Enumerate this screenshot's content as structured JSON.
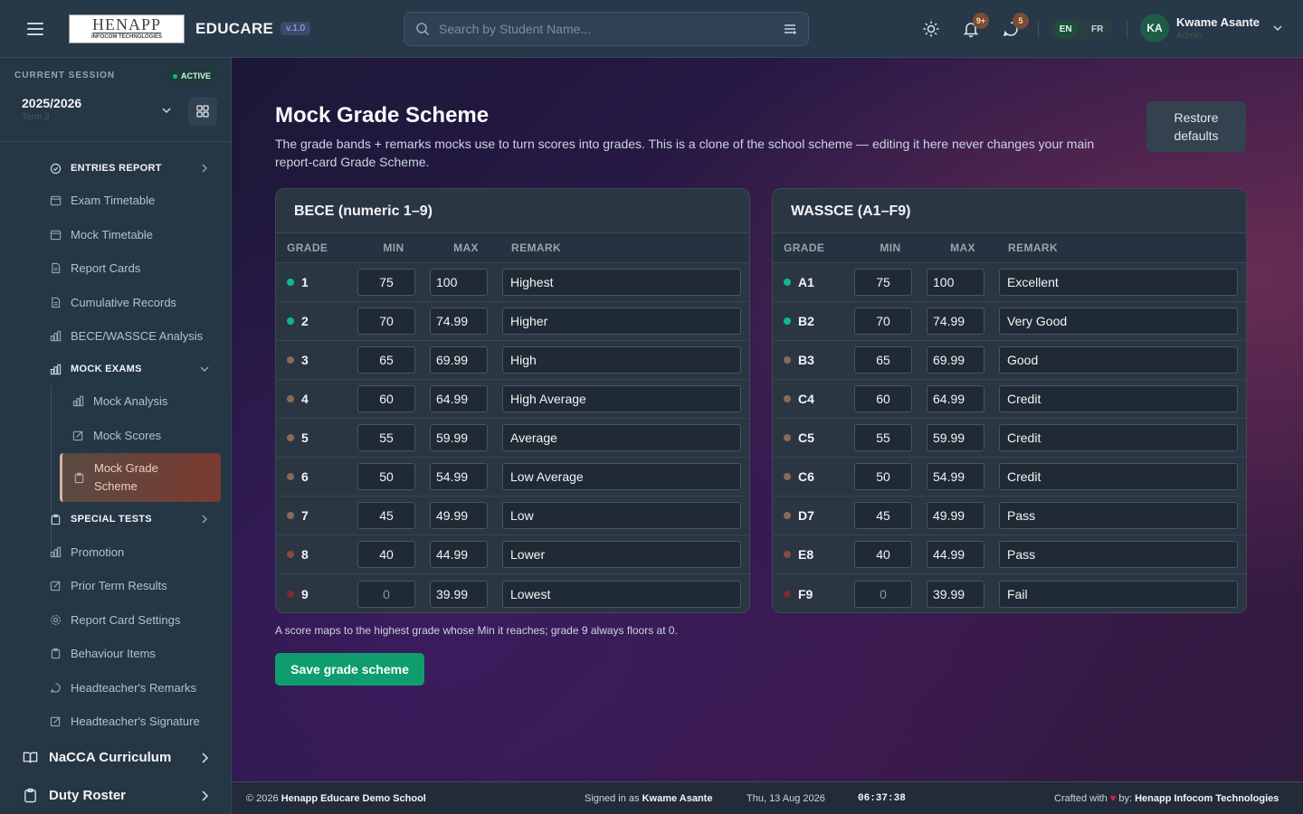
{
  "header": {
    "logo_big": "HENAPP",
    "logo_small": "INFOCOM TECHNOLOGIES",
    "brand": "EDUCARE",
    "version": "v.1.0",
    "search_placeholder": "Search by Student Name...",
    "notifications_badge": "9+",
    "messages_badge": "5",
    "lang_en": "EN",
    "lang_fr": "FR",
    "user_initials": "KA",
    "user_name": "Kwame Asante",
    "user_role": "Admin"
  },
  "sidebar": {
    "session_label": "CURRENT SESSION",
    "active_label": "ACTIVE",
    "session_year": "2025/2026",
    "session_term": "Term 3",
    "entries_report": "ENTRIES REPORT",
    "exam_timetable": "Exam Timetable",
    "mock_timetable": "Mock Timetable",
    "report_cards": "Report Cards",
    "cumulative_records": "Cumulative Records",
    "bece_wassce_analysis": "BECE/WASSCE Analysis",
    "mock_exams": "MOCK EXAMS",
    "mock_analysis": "Mock Analysis",
    "mock_scores": "Mock Scores",
    "mock_grade_scheme_line1": "Mock Grade",
    "mock_grade_scheme_line2": "Scheme",
    "special_tests": "SPECIAL TESTS",
    "promotion": "Promotion",
    "prior_term_results": "Prior Term Results",
    "report_card_settings": "Report Card Settings",
    "behaviour_items": "Behaviour Items",
    "headteachers_remarks": "Headteacher's Remarks",
    "headteachers_signature": "Headteacher's Signature",
    "nacca_curriculum": "NaCCA Curriculum",
    "duty_roster": "Duty Roster"
  },
  "main": {
    "title": "Mock Grade Scheme",
    "description": "The grade bands + remarks mocks use to turn scores into grades. This is a clone of the school scheme — editing it here never changes your main report-card Grade Scheme.",
    "restore_line1": "Restore",
    "restore_line2": "defaults",
    "columns": {
      "grade": "GRADE",
      "min": "MIN",
      "max": "MAX",
      "remark": "REMARK"
    },
    "bece": {
      "title": "BECE (numeric 1–9)",
      "rows": [
        {
          "grade": "1",
          "min": "75",
          "max": "100",
          "remark": "Highest",
          "color": "#10b981"
        },
        {
          "grade": "2",
          "min": "70",
          "max": "74.99",
          "remark": "Higher",
          "color": "#10b981"
        },
        {
          "grade": "3",
          "min": "65",
          "max": "69.99",
          "remark": "High",
          "color": "#8a6a55"
        },
        {
          "grade": "4",
          "min": "60",
          "max": "64.99",
          "remark": "High Average",
          "color": "#8a6a55"
        },
        {
          "grade": "5",
          "min": "55",
          "max": "59.99",
          "remark": "Average",
          "color": "#8a6a55"
        },
        {
          "grade": "6",
          "min": "50",
          "max": "54.99",
          "remark": "Low Average",
          "color": "#8a6a55"
        },
        {
          "grade": "7",
          "min": "45",
          "max": "49.99",
          "remark": "Low",
          "color": "#8a6a55"
        },
        {
          "grade": "8",
          "min": "40",
          "max": "44.99",
          "remark": "Lower",
          "color": "#8a4a40"
        },
        {
          "grade": "9",
          "min": "0",
          "max": "39.99",
          "remark": "Lowest",
          "color": "#7a2a3a"
        }
      ]
    },
    "wassce": {
      "title": "WASSCE (A1–F9)",
      "rows": [
        {
          "grade": "A1",
          "min": "75",
          "max": "100",
          "remark": "Excellent",
          "color": "#10b981"
        },
        {
          "grade": "B2",
          "min": "70",
          "max": "74.99",
          "remark": "Very Good",
          "color": "#10b981"
        },
        {
          "grade": "B3",
          "min": "65",
          "max": "69.99",
          "remark": "Good",
          "color": "#8a6a55"
        },
        {
          "grade": "C4",
          "min": "60",
          "max": "64.99",
          "remark": "Credit",
          "color": "#8a6a55"
        },
        {
          "grade": "C5",
          "min": "55",
          "max": "59.99",
          "remark": "Credit",
          "color": "#8a6a55"
        },
        {
          "grade": "C6",
          "min": "50",
          "max": "54.99",
          "remark": "Credit",
          "color": "#8a6a55"
        },
        {
          "grade": "D7",
          "min": "45",
          "max": "49.99",
          "remark": "Pass",
          "color": "#8a6a55"
        },
        {
          "grade": "E8",
          "min": "40",
          "max": "44.99",
          "remark": "Pass",
          "color": "#8a4a40"
        },
        {
          "grade": "F9",
          "min": "0",
          "max": "39.99",
          "remark": "Fail",
          "color": "#7a2a3a"
        }
      ]
    },
    "footnote": "A score maps to the highest grade whose Min it reaches; grade 9 always floors at 0.",
    "save_label": "Save grade scheme"
  },
  "footer": {
    "copyright_prefix": "© 2026",
    "school": "Henapp Educare Demo School",
    "signed_prefix": "Signed in as",
    "signed_user": "Kwame Asante",
    "date": "Thu, 13 Aug 2026",
    "time": "06:37:38",
    "crafted_prefix": "Crafted with",
    "heart": "♥",
    "crafted_by": "by:",
    "company": "Henapp Infocom Technologies"
  }
}
